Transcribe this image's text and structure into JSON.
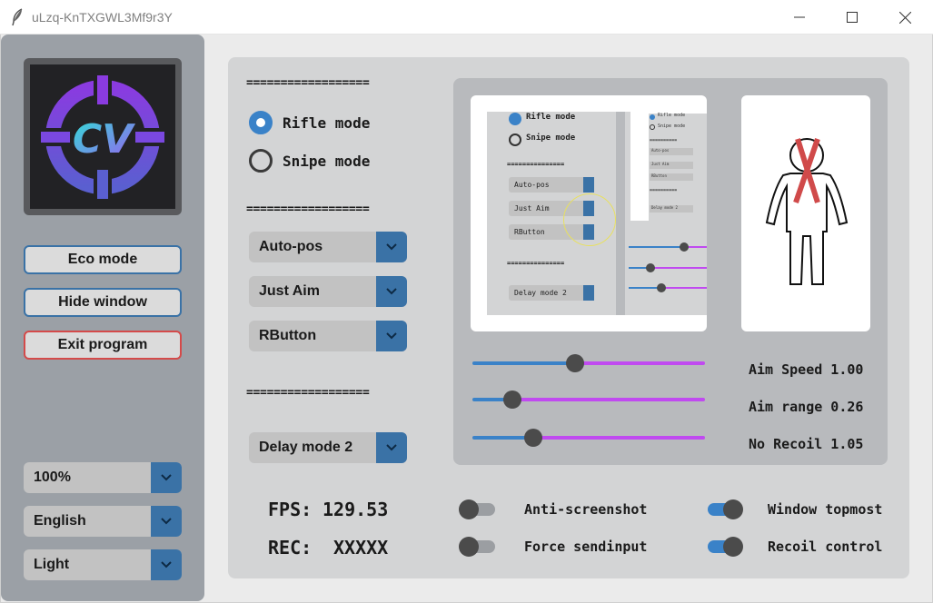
{
  "window": {
    "title": "uLzq-KnTXGWL3Mf9r3Y",
    "icon": "feather-icon",
    "controls": [
      "minimize-icon",
      "maximize-icon",
      "close-icon"
    ]
  },
  "sidebar": {
    "logo_text": "CV",
    "buttons": {
      "eco_mode": "Eco mode",
      "hide_window": "Hide window",
      "exit_program": "Exit program"
    },
    "scale_select": "100%",
    "language_select": "English",
    "theme_select": "Light"
  },
  "main": {
    "separator": "==================",
    "modes": {
      "rifle": {
        "label": "Rifle mode",
        "selected": true
      },
      "snipe": {
        "label": "Snipe mode",
        "selected": false
      }
    },
    "selects": {
      "position": "Auto-pos",
      "aim_type": "Just Aim",
      "trigger_key": "RButton",
      "delay": "Delay mode 2"
    }
  },
  "preview": {
    "mini": {
      "rifle": "Rifle mode",
      "snipe": "Snipe mode",
      "separator": "===============",
      "position": "Auto-pos",
      "aim_type": "Just Aim",
      "trigger_key": "RButton",
      "delay": "Delay mode 2",
      "tiny_rifle": "Rifle mode",
      "tiny_snipe": "Snipe mode",
      "tiny_sep": "==========",
      "tiny_pos": "Auto-pos",
      "tiny_aim": "Just Aim",
      "tiny_key": "RButton",
      "tiny_delay": "Delay mode 2"
    }
  },
  "sliders": {
    "aim_speed": {
      "label": "Aim Speed 1.00",
      "fraction": 0.44
    },
    "aim_range": {
      "label": "Aim range 0.26",
      "fraction": 0.17
    },
    "no_recoil": {
      "label": "No Recoil 1.05",
      "fraction": 0.26
    }
  },
  "stats": {
    "fps_label": "FPS:",
    "fps_value": "129.53",
    "rec_label": "REC:",
    "rec_value": "XXXXX"
  },
  "switches": {
    "anti_screenshot": {
      "label": "Anti-screenshot",
      "on": false
    },
    "force_sendinput": {
      "label": "Force sendinput",
      "on": false
    },
    "window_topmost": {
      "label": "Window topmost",
      "on": true
    },
    "recoil_control": {
      "label": "Recoil control",
      "on": true
    }
  },
  "colors": {
    "accent": "#3a82c8",
    "dropdown_arrow": "#3a72a6",
    "slider_right": "#c04af0",
    "exit_border": "#d44a4a",
    "sidebar": "#9ba0a6",
    "panel": "#d3d4d5"
  }
}
